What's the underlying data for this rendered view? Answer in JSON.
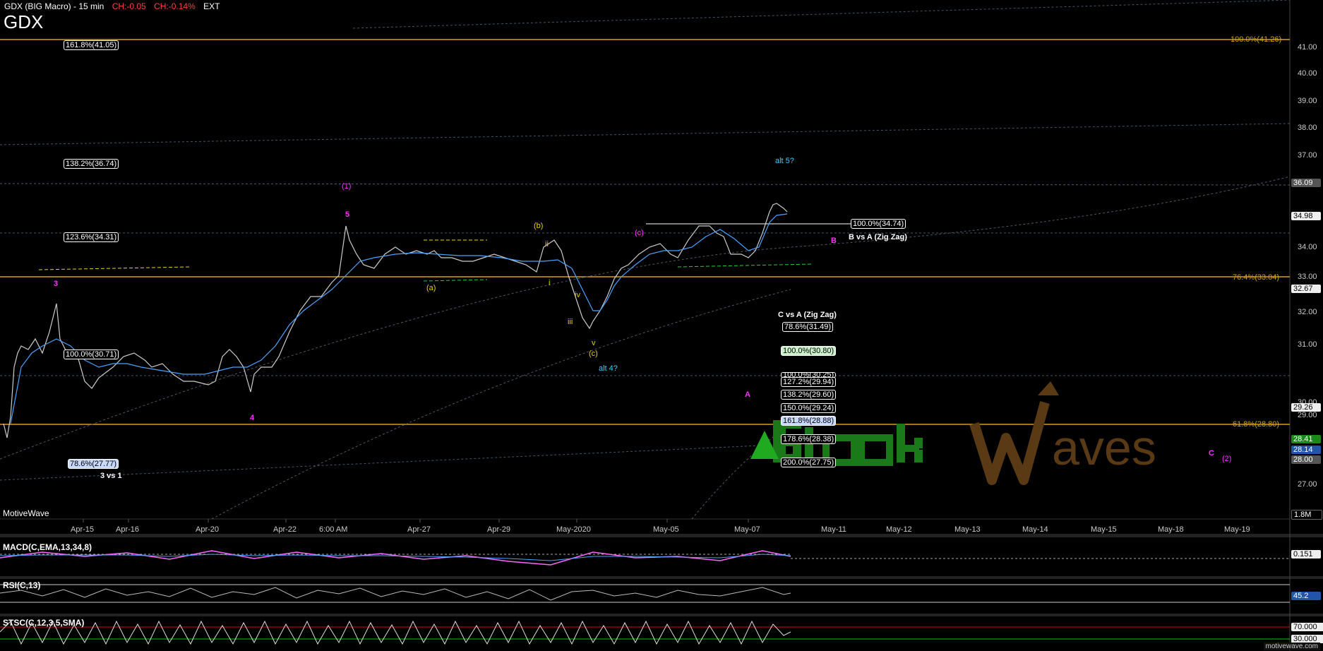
{
  "header": {
    "title": "GDX (BIG Macro) - 15 min",
    "change_abs": "CH:-0.05",
    "change_pct": "CH:-0.14%",
    "session": "EXT",
    "symbol": "GDX"
  },
  "watermark_left": "MotiveWave",
  "footer_brand": "motivewave.com",
  "colors": {
    "background": "#000000",
    "fib_gold": "#d4a017",
    "price_line": "#ffffff",
    "ma_blue": "#4aa3ff",
    "green_line": "#2ecc40",
    "magenta": "#ff33ff",
    "cyan": "#3ad0ff",
    "yellow": "#e6d200"
  },
  "price_axis": {
    "ticks": [
      "41.00",
      "40.00",
      "39.00",
      "38.00",
      "37.00",
      "34.00",
      "33.00",
      "32.00",
      "31.00",
      "30.00",
      "29.00",
      "27.00"
    ],
    "badges": [
      {
        "label": "36.09",
        "style": "gray"
      },
      {
        "label": "34.98",
        "style": "white"
      },
      {
        "label": "32.67",
        "style": "white"
      },
      {
        "label": "29.26",
        "style": "white"
      },
      {
        "label": "28.41",
        "style": "green"
      },
      {
        "label": "28.14",
        "style": "blue"
      },
      {
        "label": "28.00",
        "style": "gray"
      },
      {
        "label": "1.8M",
        "style": "black"
      }
    ]
  },
  "time_axis": {
    "labels": [
      "Apr-15",
      "Apr-16",
      "Apr-20",
      "Apr-22",
      "6:00 AM",
      "Apr-27",
      "Apr-29",
      "May-2020",
      "May-05",
      "May-07",
      "May-11",
      "May-12",
      "May-13",
      "May-14",
      "May-15",
      "May-18",
      "May-19"
    ]
  },
  "fib_boxes": {
    "left": [
      {
        "label": "161.8%(41.05)"
      },
      {
        "label": "138.2%(36.74)"
      },
      {
        "label": "123.6%(34.31)"
      },
      {
        "label": "100.0%(30.71)"
      },
      {
        "label": "78.6%(27.77)"
      }
    ],
    "b_vs_a": {
      "box": "100.0%(34.74)",
      "caption": "B vs A (Zig Zag)"
    },
    "c_vs_a_title": "C vs A (Zig Zag)",
    "c_vs_a": [
      {
        "label": "78.6%(31.49)"
      },
      {
        "label": "100.0%(30.80)"
      },
      {
        "label": "100.0%(30.25)"
      },
      {
        "label": "127.2%(29.94)"
      },
      {
        "label": "138.2%(29.60)"
      },
      {
        "label": "150.0%(29.24)"
      },
      {
        "label": "161.8%(28.88)"
      },
      {
        "label": "178.6%(28.38)"
      },
      {
        "label": "200.0%(27.75)"
      }
    ],
    "right_gold": [
      {
        "label": "100.0%(41.26)"
      },
      {
        "label": "76.4%(33.04)"
      },
      {
        "label": "61.8%(28.80)"
      }
    ],
    "three_vs_one": "3 vs 1"
  },
  "wave_labels": {
    "alt5": "alt 5?",
    "alt4": "alt 4?",
    "w1": "(1)",
    "w2": "(2)",
    "w3": "3",
    "w4": "4",
    "w5": "5",
    "B": "B",
    "C": "C",
    "A": "A",
    "a_paren": "(a)",
    "b_paren": "(b)",
    "c_paren": "(c)",
    "c_paren2": "(c)",
    "i": "i",
    "iii": "iii",
    "iv": "iv",
    "v": "v",
    "ii": "ii"
  },
  "indicators": {
    "macd": {
      "label": "MACD(C,EMA,13,34,8)",
      "value": "0.151"
    },
    "rsi": {
      "label": "RSI(C,13)",
      "value": "45.2"
    },
    "stoch": {
      "label": "STSC(C,12,3,5,SMA)",
      "value_top": "70.000",
      "value_bot": "30.000"
    }
  },
  "logo_text": "StockWaves"
}
